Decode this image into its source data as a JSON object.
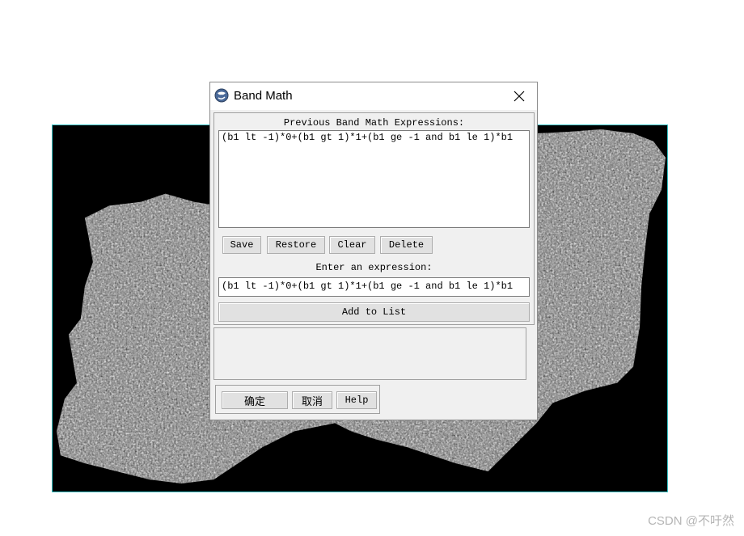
{
  "window": {
    "title": "Band Math",
    "icon": "globe-icon",
    "close_icon": "close-icon"
  },
  "previous_expressions": {
    "heading": "Previous Band Math Expressions:",
    "items": [
      "(b1 lt -1)*0+(b1 gt 1)*1+(b1 ge -1 and b1 le 1)*b1"
    ]
  },
  "list_buttons": {
    "save": "Save",
    "restore": "Restore",
    "clear": "Clear",
    "delete": "Delete"
  },
  "expression": {
    "label": "Enter an expression:",
    "value": "(b1 lt -1)*0+(b1 gt 1)*1+(b1 ge -1 and b1 le 1)*b1",
    "add_to_list": "Add to List"
  },
  "dialog_buttons": {
    "ok": "确定",
    "cancel": "取消",
    "help": "Help"
  },
  "watermark": "CSDN @不吁然",
  "colors": {
    "raster_border": "#37c3c6",
    "dialog_bg": "#f0f0f0"
  }
}
